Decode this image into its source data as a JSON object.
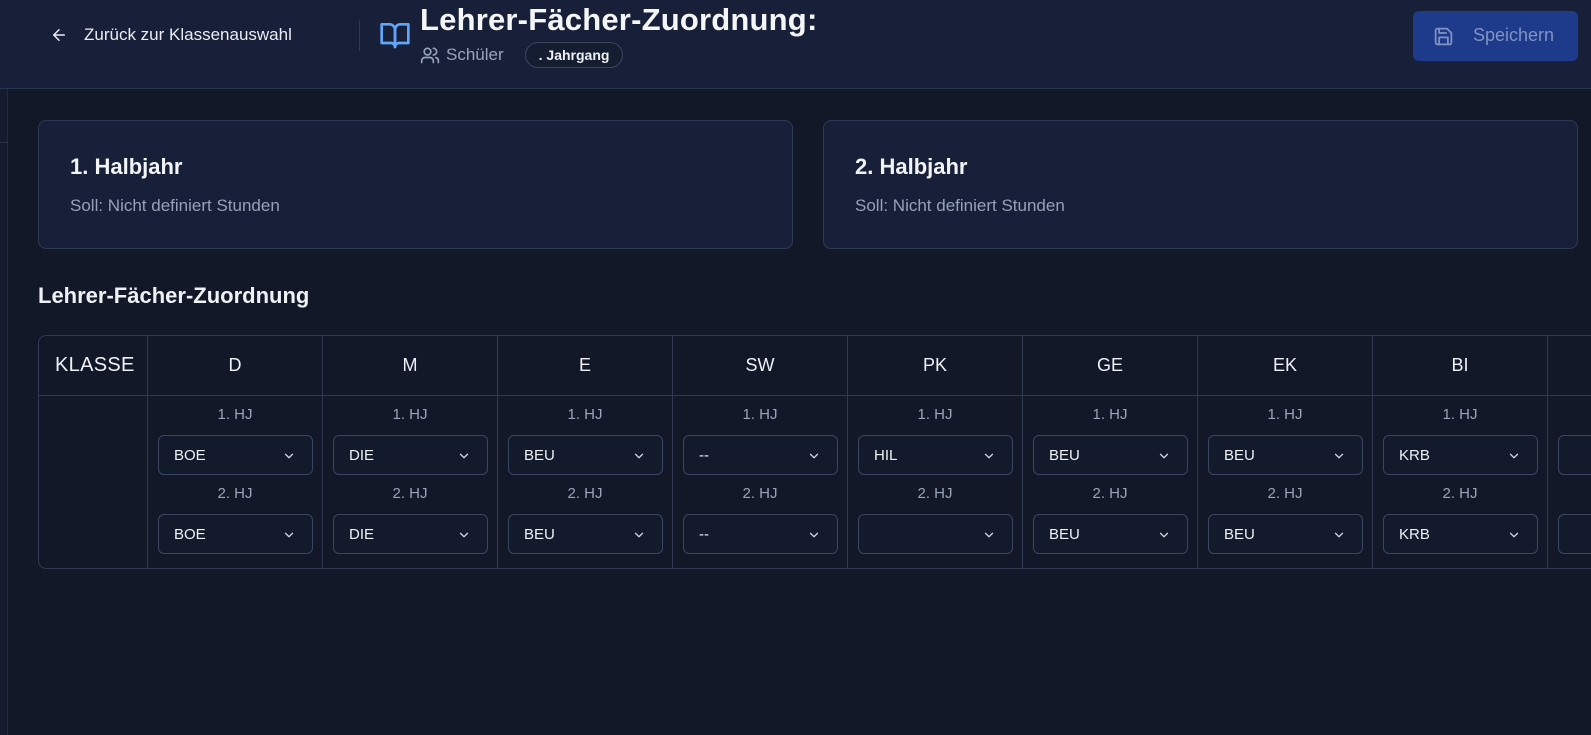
{
  "header": {
    "back_label": "Zurück zur Klassenauswahl",
    "title": "Lehrer-Fächer-Zuordnung:",
    "students_label": "Schüler",
    "grade_badge": ". Jahrgang",
    "save_label": "Speichern"
  },
  "halbjahre": [
    {
      "title": "1. Halbjahr",
      "subtitle": "Soll: Nicht definiert Stunden"
    },
    {
      "title": "2. Halbjahr",
      "subtitle": "Soll: Nicht definiert Stunden"
    }
  ],
  "section_title": "Lehrer-Fächer-Zuordnung",
  "table": {
    "klasse_header": "KLASSE",
    "hj1_label": "1. HJ",
    "hj2_label": "2. HJ",
    "subjects": [
      {
        "name": "D",
        "hj1": "BOE",
        "hj2": "BOE"
      },
      {
        "name": "M",
        "hj1": "DIE",
        "hj2": "DIE"
      },
      {
        "name": "E",
        "hj1": "BEU",
        "hj2": "BEU"
      },
      {
        "name": "SW",
        "hj1": "--",
        "hj2": "--"
      },
      {
        "name": "PK",
        "hj1": "HIL",
        "hj2": ""
      },
      {
        "name": "GE",
        "hj1": "BEU",
        "hj2": "BEU"
      },
      {
        "name": "EK",
        "hj1": "BEU",
        "hj2": "BEU"
      },
      {
        "name": "BI",
        "hj1": "KRB",
        "hj2": "KRB"
      }
    ]
  },
  "colors": {
    "background": "#121828",
    "header_bg": "#172038",
    "primary_button": "#1e3a8a",
    "icon_accent": "#60a5fa"
  }
}
